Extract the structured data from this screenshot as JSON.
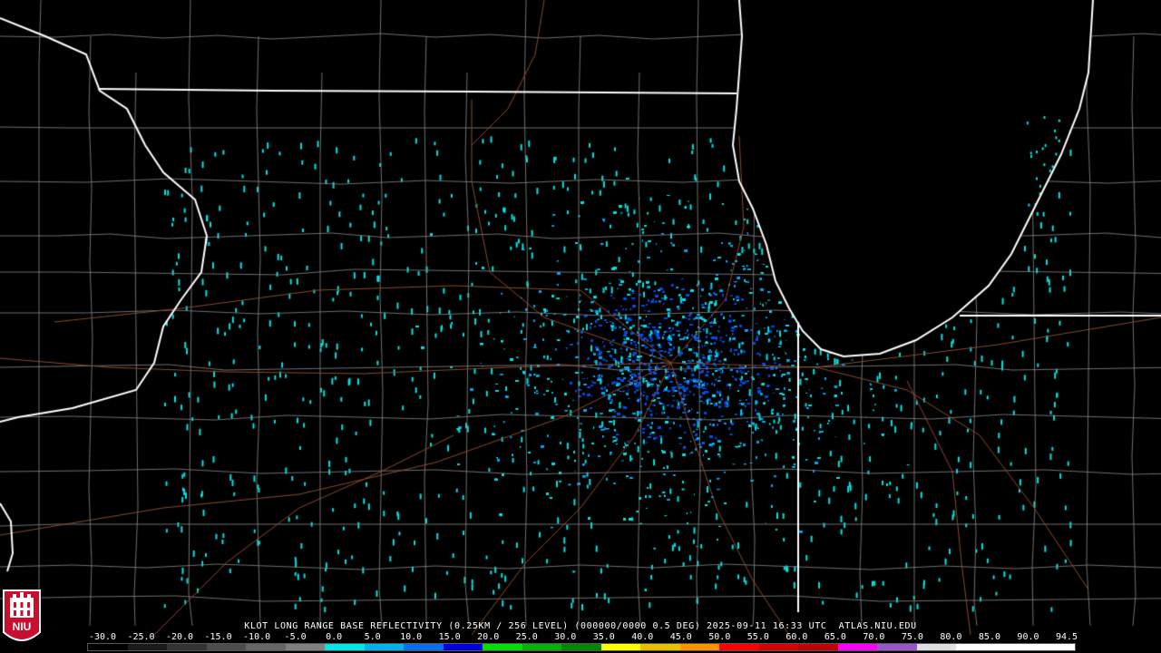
{
  "caption": "KLOT LONG RANGE BASE REFLECTIVITY (0.25KM / 256 LEVEL) (000000/0000 0.5 DEG) 2025-09-11 16:33 UTC  ATLAS.NIU.EDU",
  "logo_text": "NIU",
  "scale": {
    "labels": [
      "-30.0",
      "-25.0",
      "-20.0",
      "-15.0",
      "-10.0",
      "-5.0",
      "0.0",
      "5.0",
      "10.0",
      "15.0",
      "20.0",
      "25.0",
      "30.0",
      "35.0",
      "40.0",
      "45.0",
      "50.0",
      "55.0",
      "60.0",
      "65.0",
      "70.0",
      "75.0",
      "80.0",
      "85.0",
      "90.0",
      "94.5"
    ],
    "colors": [
      "#000000",
      "#1a1a1a",
      "#333333",
      "#4d4d4d",
      "#666666",
      "#808080",
      "#00e5e5",
      "#00b0f0",
      "#0070f0",
      "#0000e0",
      "#00e000",
      "#00b400",
      "#008800",
      "#ffff00",
      "#e7c000",
      "#ff9000",
      "#ff0000",
      "#d60000",
      "#c00000",
      "#ff00ff",
      "#9955c9",
      "#e0e0e0",
      "#ffffff",
      "#ffffff",
      "#ffffff"
    ]
  },
  "colors": {
    "background": "#000000",
    "state_border": "#ffffff",
    "county_border": "#8a8a8a",
    "highway": "#8b4a2a",
    "echo_light": "#00e5e5",
    "echo_mid": "#00a8f0",
    "echo_deep": "#0050e8",
    "logo_red": "#c8102e"
  }
}
